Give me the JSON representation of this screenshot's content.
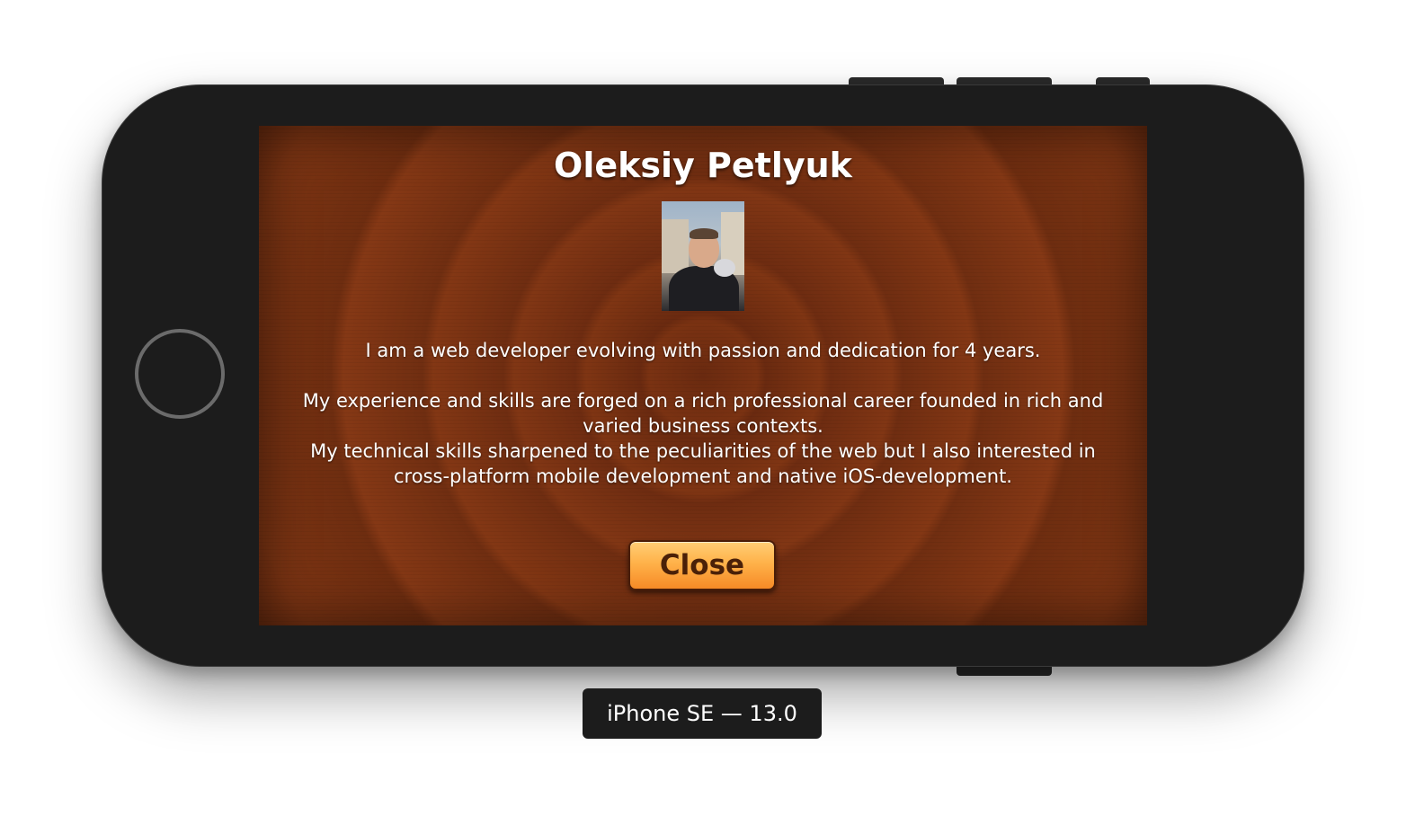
{
  "simulator": {
    "device_label": "iPhone SE — 13.0"
  },
  "screen": {
    "title": "Oleksiy Petlyuk",
    "bio_line_1": "I am a web developer evolving with passion and dedication for 4 years.",
    "bio_line_2": "My experience and skills are forged on a rich professional career founded in rich and varied business contexts.",
    "bio_line_3": "My technical skills sharpened to the peculiarities of the web but I also interested in cross-platform mobile development and native iOS-development.",
    "close_label": "Close"
  },
  "colors": {
    "background_brown": "#7a3212",
    "button_orange": "#ffb24a",
    "button_text": "#4a2008",
    "device_body": "#1c1c1c"
  }
}
